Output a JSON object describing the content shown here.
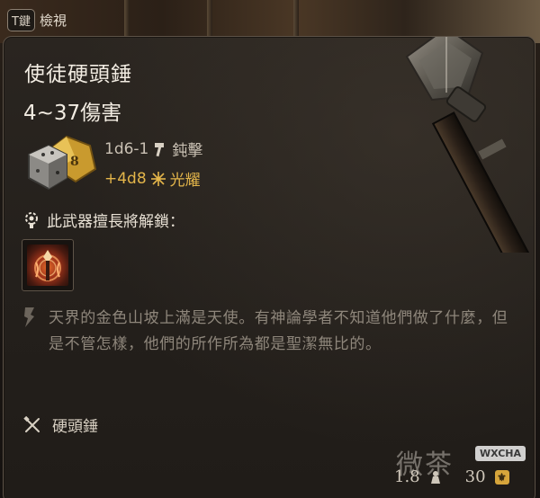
{
  "hint": {
    "key": "T鍵",
    "label": "檢視"
  },
  "item": {
    "name": "使徒硬頭錘",
    "damage_total": "4~37傷害",
    "damage_lines": [
      {
        "dice": "1d6-1",
        "type_icon": "hammer-icon",
        "type": "鈍擊",
        "color": "#c9c0b3"
      },
      {
        "dice": "+4d8",
        "type_icon": "radiant-icon",
        "type": "光耀",
        "color": "#e3b54a"
      }
    ],
    "unlock_text": "此武器擅長將解鎖：",
    "skill_icon": "weapon-action-icon",
    "lore": "天界的金色山坡上滿是天使。有神論學者不知道他們做了什麼，但是不管怎樣，他們的所作所為都是聖潔無比的。",
    "category": "硬頭錘",
    "weight": "1.8",
    "value": "30"
  },
  "watermark": {
    "text": "微茶",
    "badge": "WXCHA"
  },
  "colors": {
    "panel_bg": "#24201c",
    "border": "#5c5247",
    "title": "#f2ece2",
    "radiant": "#e3b54a",
    "lore": "#8e867b"
  }
}
